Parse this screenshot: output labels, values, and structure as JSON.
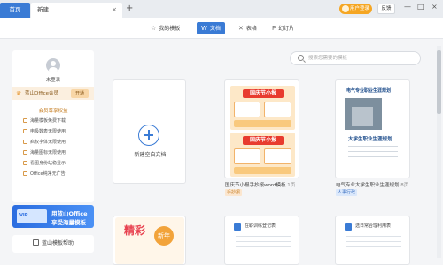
{
  "titlebar": {
    "home_tab": "首页",
    "new_tab": "新建",
    "close_glyph": "×",
    "plus_glyph": "+",
    "user_button": "用户登录",
    "feedback": "反馈",
    "minimize": "—",
    "maximize": "□",
    "close": "×"
  },
  "toolbar": {
    "items": [
      {
        "label": "我的模板",
        "icon": "star-icon"
      },
      {
        "label": "文档",
        "icon": "word-icon"
      },
      {
        "label": "表格",
        "icon": "table-icon"
      },
      {
        "label": "幻灯片",
        "icon": "slides-icon"
      }
    ],
    "active_index": 1
  },
  "sidebar": {
    "login_text": "未登录",
    "member_label": "蓝山Office会员",
    "member_open": "开通",
    "perks_title": "会员尊享权益",
    "perks": [
      "海量模板免费下载",
      "电极数表无限使用",
      "疯权字体无限使用",
      "海量图标无限使用",
      "看图身份站稳显示",
      "Office纯净无广告"
    ],
    "promo_line1": "用蓝山Office",
    "promo_line2": "享受海量模板",
    "help": "蓝山模板帮助"
  },
  "search": {
    "placeholder": "搜索您需要的模板",
    "value": ""
  },
  "blank": {
    "label": "新建空白文档"
  },
  "templates": [
    {
      "title": "国庆节小报手抄报word模板",
      "pages": "1页",
      "tag": "手抄报",
      "poster_text": "国庆节小报",
      "poster_text2": "国庆节小报"
    },
    {
      "title": "电气专业大学生职业生涯规划",
      "pages": "8页",
      "tag": "人事行政",
      "head": "电气专业职业生涯规划",
      "inner_title": "大学生职业生涯规划"
    }
  ],
  "bottom_cards": [
    {
      "poster": "精彩",
      "sub": "新年"
    },
    {
      "title": "在职训练登记表"
    },
    {
      "title": "选日常合理利用表"
    }
  ],
  "colors": {
    "accent": "#3a7bd5",
    "user_button": "#f5a623",
    "member_bg": "#fbefdf"
  }
}
